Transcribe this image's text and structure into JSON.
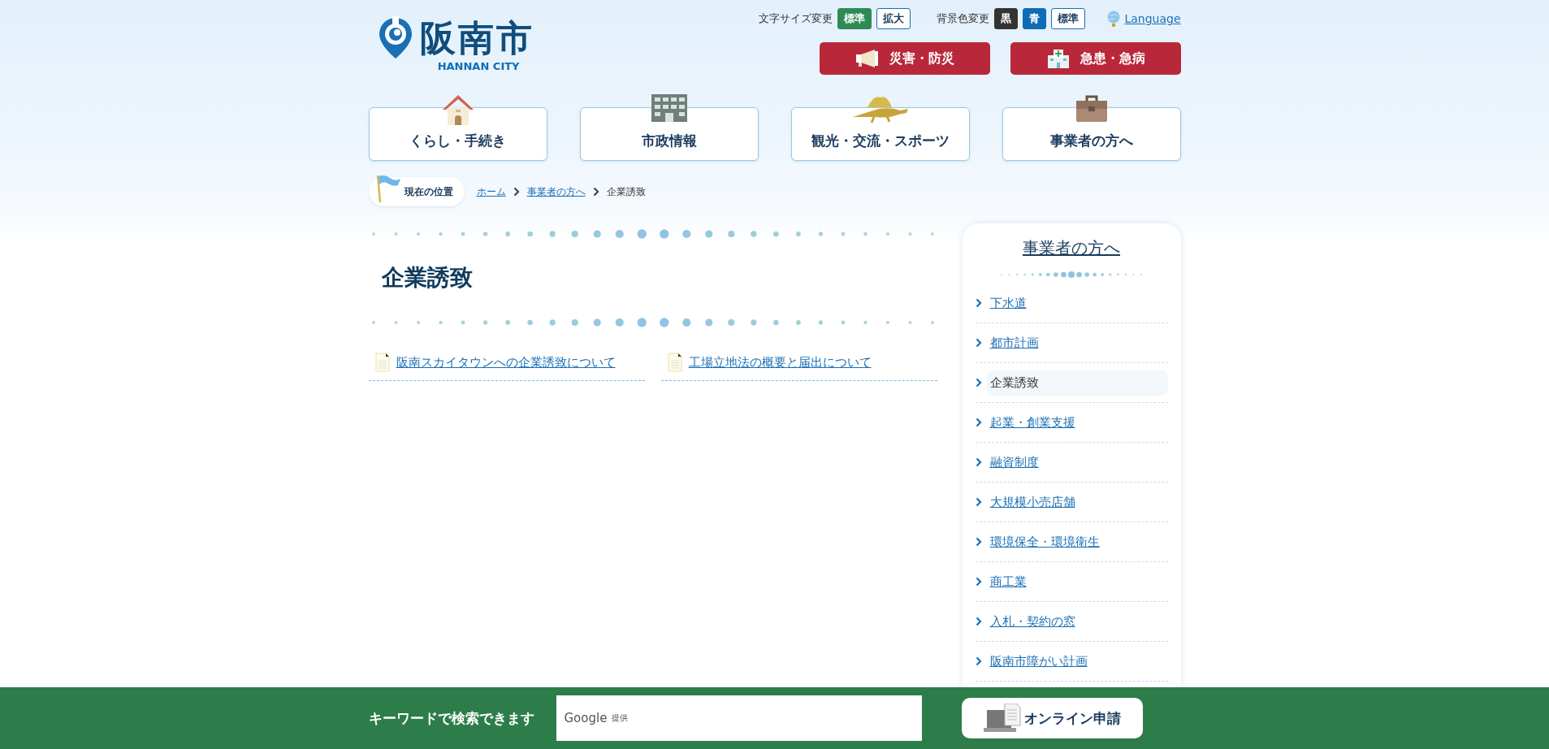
{
  "header": {
    "logo": {
      "name": "阪南市",
      "subtitle": "HANNAN CITY"
    },
    "font_size": {
      "label": "文字サイズ変更",
      "options": [
        {
          "label": "標準",
          "selected": true
        },
        {
          "label": "拡大",
          "selected": false
        }
      ]
    },
    "background_color": {
      "label": "背景色変更",
      "options": [
        {
          "label": "黒",
          "color": "#333333"
        },
        {
          "label": "青",
          "color": "#0f6db5"
        },
        {
          "label": "標準",
          "color": "#ffffff"
        }
      ]
    },
    "language": "Language",
    "emergency_buttons": [
      "災害・防災",
      "急患・急病"
    ],
    "nav": [
      "くらし・手続き",
      "市政情報",
      "観光・交流・スポーツ",
      "事業者の方へ"
    ]
  },
  "breadcrumb": {
    "label": "現在の位置",
    "items": [
      {
        "text": "ホーム",
        "current": false
      },
      {
        "text": "事業者の方へ",
        "current": false
      },
      {
        "text": "企業誘致",
        "current": true
      }
    ]
  },
  "page_title": "企業誘致",
  "links": [
    "阪南スカイタウンへの企業誘致について",
    "工場立地法の概要と届出について"
  ],
  "sidebar": {
    "title": "事業者の方へ",
    "items": [
      {
        "label": "下水道",
        "selected": false
      },
      {
        "label": "都市計画",
        "selected": false
      },
      {
        "label": "企業誘致",
        "selected": true
      },
      {
        "label": "起業・創業支援",
        "selected": false
      },
      {
        "label": "融資制度",
        "selected": false
      },
      {
        "label": "大規模小売店舗",
        "selected": false
      },
      {
        "label": "環境保全・環境衛生",
        "selected": false
      },
      {
        "label": "商工業",
        "selected": false
      },
      {
        "label": "入札・契約の窓",
        "selected": false
      },
      {
        "label": "阪南市障がい計画",
        "selected": false
      }
    ]
  },
  "footer": {
    "search_label": "キーワードで検索できます",
    "search_field": {
      "brand": "Google",
      "note": "提供"
    },
    "online_button": "オンライン申請"
  }
}
